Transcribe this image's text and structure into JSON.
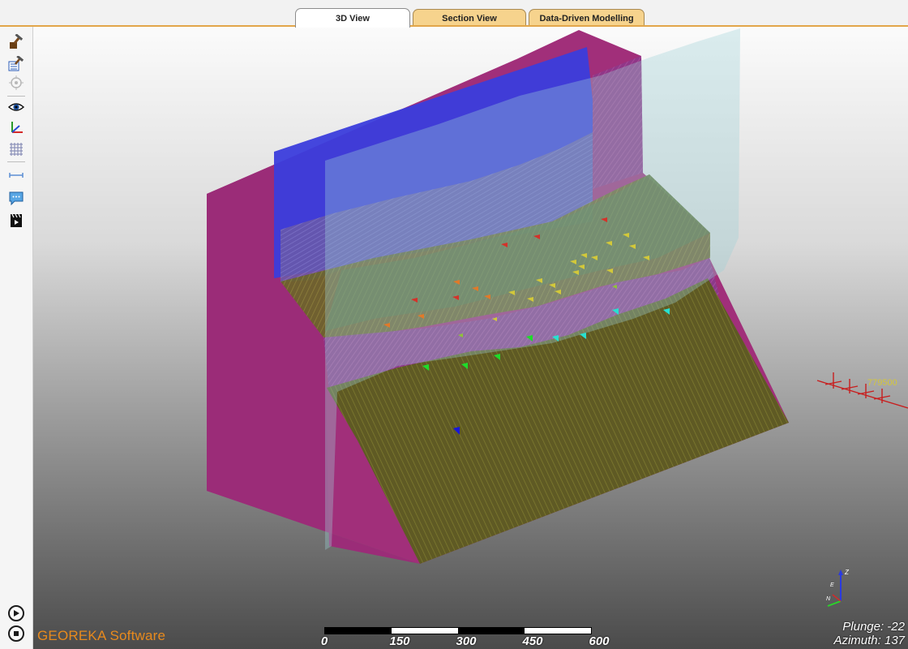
{
  "tabs": [
    {
      "label": "3D View",
      "active": true
    },
    {
      "label": "Section View",
      "active": false
    },
    {
      "label": "Data-Driven Modelling",
      "active": false
    }
  ],
  "toolbar": {
    "icons": [
      "hammer-rock-icon",
      "hammer-list-icon",
      "target-icon",
      "eye-icon",
      "axes-icon",
      "grid-icon",
      "ruler-icon",
      "speech-bubble-icon",
      "clapperboard-icon"
    ],
    "bottom_buttons": [
      "play-icon",
      "stop-icon"
    ]
  },
  "viewport": {
    "brand": "GEOREKA Software",
    "coordinate_label": "779500",
    "scale": {
      "labels": [
        "0",
        "150",
        "300",
        "450",
        "600"
      ]
    },
    "orientation": {
      "plunge": "Plunge: -22",
      "azimuth": "Azimuth: 137"
    },
    "compass": {
      "z": "Z",
      "e": "E",
      "n": "N"
    }
  },
  "colors": {
    "tab_active": "#ffffff",
    "tab_inactive": "#f6d38d",
    "accent": "#e2a64a",
    "magenta_layer": "#a6307e",
    "blue_layer": "#3a3ad4",
    "olive_layer": "#6d6a2a",
    "brand": "#e88a1d"
  }
}
